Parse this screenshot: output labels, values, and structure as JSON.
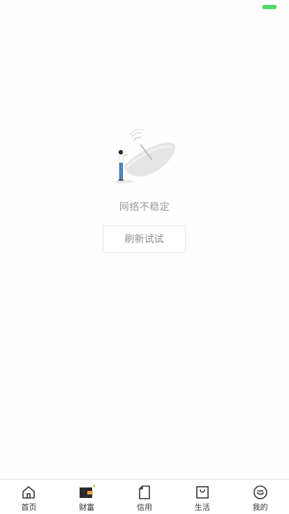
{
  "status_bar": {
    "battery_color": "#4cd964"
  },
  "empty_state": {
    "illustration": "satellite-dish-person-illustration",
    "title": "网络不稳定",
    "refresh_label": "刷新试试"
  },
  "tab_bar": {
    "items": [
      {
        "label": "首页",
        "icon": "home-icon",
        "active": false
      },
      {
        "label": "财富",
        "icon": "wallet-icon",
        "active": true
      },
      {
        "label": "信用",
        "icon": "card-icon",
        "active": false
      },
      {
        "label": "生活",
        "icon": "shopping-bag-icon",
        "active": false
      },
      {
        "label": "我的",
        "icon": "smiley-icon",
        "active": false
      }
    ],
    "accent_color": "#f2a23a"
  }
}
